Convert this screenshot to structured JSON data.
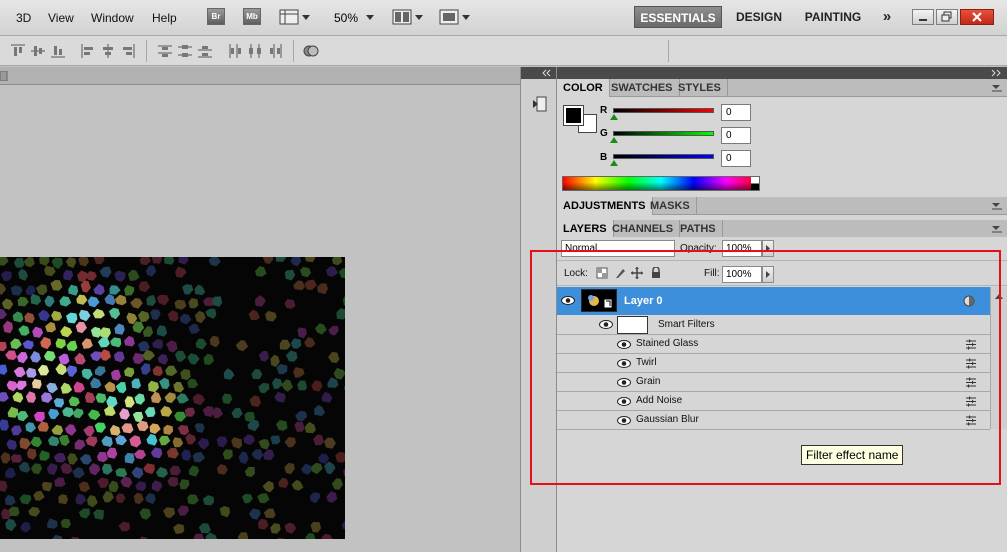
{
  "menu": {
    "items": [
      "3D",
      "View",
      "Window",
      "Help"
    ]
  },
  "app_buttons": {
    "bridge": "Br",
    "mini_bridge": "Mb"
  },
  "zoom": {
    "value": "50%"
  },
  "workspaces": {
    "essentials": "ESSENTIALS",
    "design": "DESIGN",
    "painting": "PAINTING",
    "more": "»"
  },
  "color_panel": {
    "tabs": [
      "COLOR",
      "SWATCHES",
      "STYLES"
    ],
    "channels": [
      {
        "label": "R",
        "value": "0",
        "gradient": [
          "#000000",
          "#ff0000"
        ]
      },
      {
        "label": "G",
        "value": "0",
        "gradient": [
          "#000000",
          "#00ff00"
        ]
      },
      {
        "label": "B",
        "value": "0",
        "gradient": [
          "#000000",
          "#0000ff"
        ]
      }
    ]
  },
  "adjustments_panel": {
    "tabs": [
      "ADJUSTMENTS",
      "MASKS"
    ]
  },
  "layers_panel": {
    "tabs": [
      "LAYERS",
      "CHANNELS",
      "PATHS"
    ],
    "blend_mode": "Normal",
    "opacity_label": "Opacity:",
    "opacity_value": "100%",
    "lock_label": "Lock:",
    "fill_label": "Fill:",
    "fill_value": "100%",
    "layer_name": "Layer 0",
    "smart_filters_label": "Smart Filters",
    "filters": [
      "Stained Glass",
      "Twirl",
      "Grain",
      "Add Noise",
      "Gaussian Blur"
    ]
  },
  "tooltip": {
    "text": "Filter effect name"
  },
  "colors": {
    "highlight": "#e3101a",
    "layer_selected": "#3d8fdb",
    "workspace_active": "#7a7a7a"
  }
}
